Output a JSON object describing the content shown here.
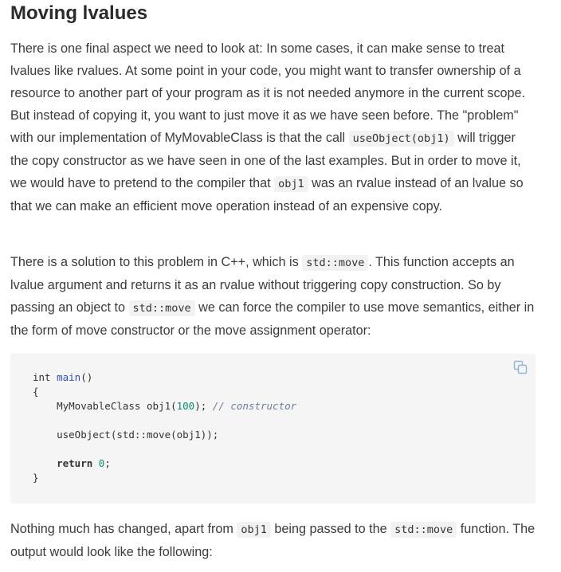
{
  "heading": "Moving lvalues",
  "para1": {
    "t1": "There is one final aspect we need to look at: In some cases, it can make sense to treat lvalues like rvalues. At some point in your code, you might want to transfer ownership of a resource to another part of your program as it is not needed anymore in the current scope. But instead of copying it, you want to just move it as we have seen before. The \"problem\" with our implementation of MyMovableClass is that the call ",
    "c1": "useObject(obj1)",
    "t2": " will trigger the copy constructor as we have seen in one of the last examples. But in order to move it, we would have to pretend to the compiler that ",
    "c2": "obj1",
    "t3": " was an rvalue instead of an lvalue so that we can make an efficient move operation instead of an expensive copy."
  },
  "para2": {
    "t1": "There is a solution to this problem in C++, which is ",
    "c1": "std::move",
    "t2": ". This function accepts an lvalue argument and returns it as an rvalue without triggering copy construction. So by passing an object to ",
    "c2": "std::move",
    "t3": " we can force the compiler to use move semantics, either in the form of move constructor or the move assignment operator:"
  },
  "code": {
    "l1_type": "int",
    "l1_fn": "main",
    "l1_rest": "()",
    "l2": "{",
    "l3_a": "    MyMovableClass obj1(",
    "l3_num": "100",
    "l3_b": "); ",
    "l3_comment": "// constructor",
    "l4": "    useObject(std::move(obj1));",
    "l5_kw": "    return",
    "l5_sp": " ",
    "l5_num": "0",
    "l5_end": ";",
    "l6": "}"
  },
  "para3": {
    "t1": "Nothing much has changed, apart from ",
    "c1": "obj1",
    "t2": " being passed to the ",
    "c2": "std::move",
    "t3": " function. The output would look like the following:"
  },
  "icons": {
    "copy": "copy-icon"
  },
  "colors": {
    "code_bg": "#f5f5f5",
    "inline_code_bg": "#f2f2f2",
    "function": "#2f4fc8",
    "number": "#0a8a73",
    "comment": "#6a7fa0",
    "copy_icon": "#8fb3d9"
  }
}
